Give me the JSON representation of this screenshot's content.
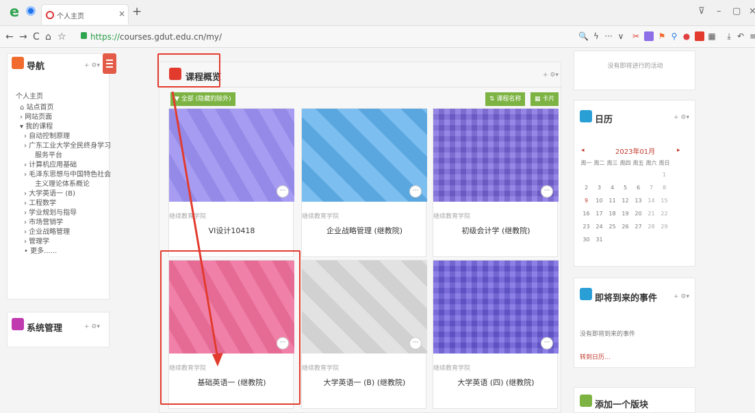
{
  "browser": {
    "tab_title": "个人主页",
    "tab_close": "×",
    "new_tab": "+",
    "url_scheme": "https://",
    "url_rest": "courses.gdut.edu.cn/my/",
    "nav": {
      "back": "←",
      "forward": "→",
      "reload": "C",
      "home": "⌂",
      "star": "☆"
    },
    "window": {
      "min": "–",
      "restore": "▢",
      "close": "×",
      "pin": "⊽"
    }
  },
  "nav_block": {
    "title": "导航",
    "ctl": "+ ⚙▾",
    "items": [
      "个人主页",
      "站点首页",
      "网站页面",
      "我的课程",
      "自动控制原理",
      "广东工业大学全民终身学习",
      "服务平台",
      "计算机应用基础",
      "毛泽东思想与中国特色社会",
      "主义理论体系概论",
      "大学英语一 (B)",
      "工程数学",
      "学业规划与指导",
      "市场营销学",
      "企业战略管理",
      "管理学",
      "更多......"
    ],
    "prefixes": [
      "",
      "⌂ ",
      "› ",
      "▾ ",
      "› ",
      "› ",
      "",
      "› ",
      "› ",
      "",
      "› ",
      "› ",
      "› ",
      "› ",
      "› ",
      "› ",
      "• "
    ]
  },
  "admin_block": {
    "title": "系统管理",
    "ctl": "+ ⚙▾"
  },
  "overview": {
    "title": "课程概览",
    "ctl": "+ ⚙▾",
    "filter_label": "▼ 全部 (隐藏的除外)",
    "sort_label": "⇅ 课程名称",
    "view_label": "▦ 卡片",
    "courses": [
      {
        "category": "继续教育学院",
        "name": "VI设计10418",
        "color": "#9a8ff0"
      },
      {
        "category": "继续教育学院",
        "name": "企业战略管理 (继教院)",
        "color": "#5fb0ec"
      },
      {
        "category": "继续教育学院",
        "name": "初级会计学 (继教院)",
        "color": "#7b67e0"
      },
      {
        "category": "继续教育学院",
        "name": "基础英语一 (继教院)",
        "color": "#ee6f9b"
      },
      {
        "category": "继续教育学院",
        "name": "大学英语一 (B) (继教院)",
        "color": "#dcdcdc"
      },
      {
        "category": "继续教育学院",
        "name": "大学英语 (四) (继教院)",
        "color": "#6d5ee0"
      }
    ],
    "more_icon": "···"
  },
  "timeline_block": {
    "text": "没有即将进行的活动"
  },
  "calendar": {
    "title": "日历",
    "ctl": "+ ⚙▾",
    "month": "2023年01月",
    "prev": "◂",
    "next": "▸",
    "weekdays": [
      "周一",
      "周二",
      "周三",
      "周四",
      "周五",
      "周六",
      "周日"
    ],
    "weeks": [
      [
        "",
        "",
        "",
        "",
        "",
        "",
        "1"
      ],
      [
        "2",
        "3",
        "4",
        "5",
        "6",
        "7",
        "8"
      ],
      [
        "9",
        "10",
        "11",
        "12",
        "13",
        "14",
        "15"
      ],
      [
        "16",
        "17",
        "18",
        "19",
        "20",
        "21",
        "22"
      ],
      [
        "23",
        "24",
        "25",
        "26",
        "27",
        "28",
        "29"
      ],
      [
        "30",
        "31",
        "",
        "",
        "",
        "",
        ""
      ]
    ]
  },
  "events_block": {
    "title": "即将到来的事件",
    "ctl": "+ ⚙▾",
    "empty": "没有即将到来的事件",
    "link": "转到日历..."
  },
  "add_block": {
    "title": "添加一个版块"
  }
}
